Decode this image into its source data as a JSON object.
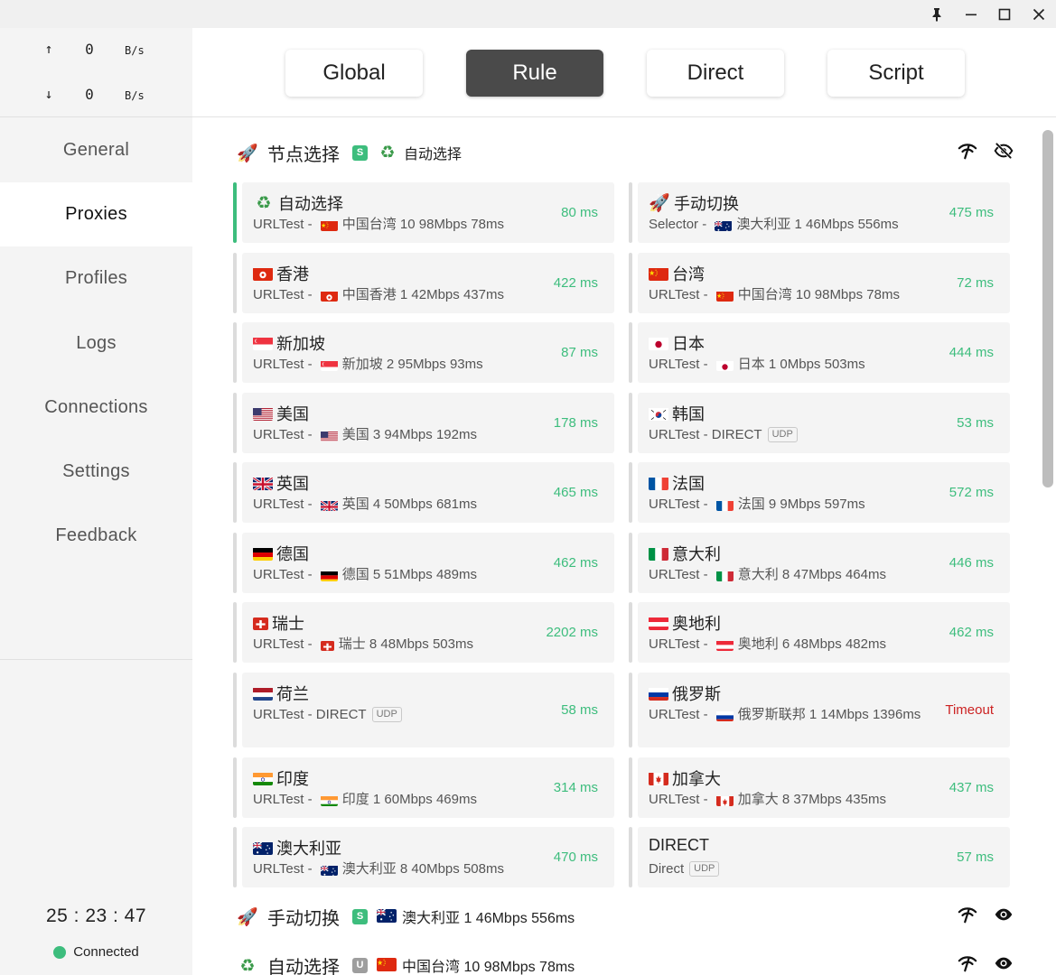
{
  "window": {
    "controls": [
      "pin-icon",
      "minimize-icon",
      "maximize-icon",
      "close-icon"
    ]
  },
  "traffic": {
    "up_arrow": "↑",
    "up_value": "0",
    "up_unit": "B/s",
    "down_arrow": "↓",
    "down_value": "0",
    "down_unit": "B/s"
  },
  "sidebar": {
    "items": [
      {
        "label": "General"
      },
      {
        "label": "Proxies"
      },
      {
        "label": "Profiles"
      },
      {
        "label": "Logs"
      },
      {
        "label": "Connections"
      },
      {
        "label": "Settings"
      },
      {
        "label": "Feedback"
      }
    ],
    "active": "Proxies",
    "clock": "25 : 23 : 47",
    "status": "Connected",
    "status_color": "#3dbd7d"
  },
  "modes": {
    "items": [
      {
        "label": "Global"
      },
      {
        "label": "Rule"
      },
      {
        "label": "Direct"
      },
      {
        "label": "Script"
      }
    ],
    "active": "Rule"
  },
  "groups": [
    {
      "icon": "rocket-icon",
      "name": "节点选择",
      "badge": "S",
      "now_icon": "recycle-icon",
      "now": "自动选择",
      "actions": [
        "latency-test-icon",
        "hide-icon"
      ]
    },
    {
      "icon": "rocket-icon",
      "name": "手动切换",
      "badge": "S",
      "now_icon": "flag-au",
      "now": "澳大利亚 1 46Mbps 556ms",
      "actions": [
        "latency-test-icon",
        "show-icon"
      ]
    },
    {
      "icon": "recycle-icon",
      "name": "自动选择",
      "badge": "U",
      "now_icon": "flag-cn",
      "now": "中国台湾 10 98Mbps 78ms",
      "actions": [
        "latency-test-icon",
        "show-icon"
      ]
    }
  ],
  "proxies": [
    {
      "name": "自动选择",
      "icon": "recycle-icon",
      "type": "URLTest - ",
      "sub_icon": "flag-cn",
      "detail": "中国台湾 10 98Mbps 78ms",
      "latency": "80 ms",
      "selected": true
    },
    {
      "name": "手动切换",
      "icon": "rocket-icon",
      "type": "Selector - ",
      "sub_icon": "flag-au",
      "detail": "澳大利亚 1 46Mbps 556ms",
      "latency": "475 ms"
    },
    {
      "name": "香港",
      "icon": "flag-hk",
      "type": "URLTest - ",
      "sub_icon": "flag-hk",
      "detail": "中国香港 1 42Mbps 437ms",
      "latency": "422 ms"
    },
    {
      "name": "台湾",
      "icon": "flag-cn",
      "type": "URLTest - ",
      "sub_icon": "flag-cn",
      "detail": "中国台湾 10 98Mbps 78ms",
      "latency": "72 ms"
    },
    {
      "name": "新加坡",
      "icon": "flag-sg",
      "type": "URLTest - ",
      "sub_icon": "flag-sg",
      "detail": "新加坡 2 95Mbps 93ms",
      "latency": "87 ms"
    },
    {
      "name": "日本",
      "icon": "flag-jp",
      "type": "URLTest - ",
      "sub_icon": "flag-jp",
      "detail": "日本 1 0Mbps 503ms",
      "latency": "444 ms"
    },
    {
      "name": "美国",
      "icon": "flag-us",
      "type": "URLTest - ",
      "sub_icon": "flag-us",
      "detail": "美国 3 94Mbps 192ms",
      "latency": "178 ms"
    },
    {
      "name": "韩国",
      "icon": "flag-kr",
      "type": "URLTest - DIRECT",
      "sub_icon": "",
      "detail": "",
      "udp": "UDP",
      "latency": "53 ms"
    },
    {
      "name": "英国",
      "icon": "flag-gb",
      "type": "URLTest - ",
      "sub_icon": "flag-gb",
      "detail": "英国 4 50Mbps 681ms",
      "latency": "465 ms"
    },
    {
      "name": "法国",
      "icon": "flag-fr",
      "type": "URLTest - ",
      "sub_icon": "flag-fr",
      "detail": "法国 9 9Mbps 597ms",
      "latency": "572 ms"
    },
    {
      "name": "德国",
      "icon": "flag-de",
      "type": "URLTest - ",
      "sub_icon": "flag-de",
      "detail": "德国 5 51Mbps 489ms",
      "latency": "462 ms"
    },
    {
      "name": "意大利",
      "icon": "flag-it",
      "type": "URLTest - ",
      "sub_icon": "flag-it",
      "detail": "意大利 8 47Mbps 464ms",
      "latency": "446 ms"
    },
    {
      "name": "瑞士",
      "icon": "flag-ch",
      "type": "URLTest - ",
      "sub_icon": "flag-ch",
      "detail": "瑞士 8 48Mbps 503ms",
      "latency": "2202 ms"
    },
    {
      "name": "奥地利",
      "icon": "flag-at",
      "type": "URLTest - ",
      "sub_icon": "flag-at",
      "detail": "奥地利 6 48Mbps 482ms",
      "latency": "462 ms"
    },
    {
      "name": "荷兰",
      "icon": "flag-nl",
      "type": "URLTest - DIRECT",
      "sub_icon": "",
      "detail": "",
      "udp": "UDP",
      "latency": "58 ms"
    },
    {
      "name": "俄罗斯",
      "icon": "flag-ru",
      "type": "URLTest - ",
      "sub_icon": "flag-ru",
      "detail": "俄罗斯联邦 1 14Mbps 1396ms",
      "latency": "Timeout",
      "timeout": true
    },
    {
      "name": "印度",
      "icon": "flag-in",
      "type": "URLTest - ",
      "sub_icon": "flag-in",
      "detail": "印度 1 60Mbps 469ms",
      "latency": "314 ms"
    },
    {
      "name": "加拿大",
      "icon": "flag-ca",
      "type": "URLTest - ",
      "sub_icon": "flag-ca",
      "detail": "加拿大 8 37Mbps 435ms",
      "latency": "437 ms"
    },
    {
      "name": "澳大利亚",
      "icon": "flag-au",
      "type": "URLTest - ",
      "sub_icon": "flag-au",
      "detail": "澳大利亚 8 40Mbps 508ms",
      "latency": "470 ms"
    },
    {
      "name": "DIRECT",
      "icon": "",
      "type": "Direct",
      "sub_icon": "",
      "detail": "",
      "udp": "UDP",
      "latency": "57 ms"
    }
  ],
  "colors": {
    "accent": "#3dbd7d",
    "timeout": "#cc2222",
    "active_mode_bg": "#4a4a4a"
  }
}
